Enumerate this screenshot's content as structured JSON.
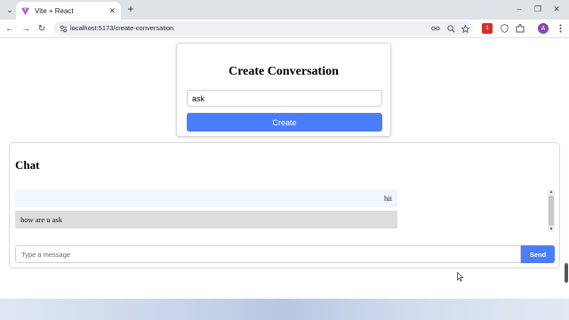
{
  "browser": {
    "tab": {
      "title": "Vite + React",
      "close_glyph": "✕"
    },
    "new_tab_glyph": "+",
    "tab_list_glyph": "⌄",
    "window_controls": {
      "minimize": "–",
      "restore": "❐",
      "close": "✕"
    },
    "nav": {
      "back": "←",
      "forward": "→",
      "reload": "↻"
    },
    "address": {
      "url": "localhost:5173/create-conversation"
    },
    "profile_initial": "A",
    "extension_badge": "1"
  },
  "create_conversation": {
    "title": "Create Conversation",
    "input_value": "ask",
    "button_label": "Create"
  },
  "chat": {
    "title": "Chat",
    "messages": [
      {
        "text": "hii",
        "align": "right"
      },
      {
        "text": "how are u ask",
        "align": "left"
      }
    ],
    "input_placeholder": "Type a message",
    "send_label": "Send"
  },
  "colors": {
    "primary_button": "#4a7dff",
    "sent_bubble": "#f0f6ff",
    "received_bubble": "#dddddd"
  }
}
